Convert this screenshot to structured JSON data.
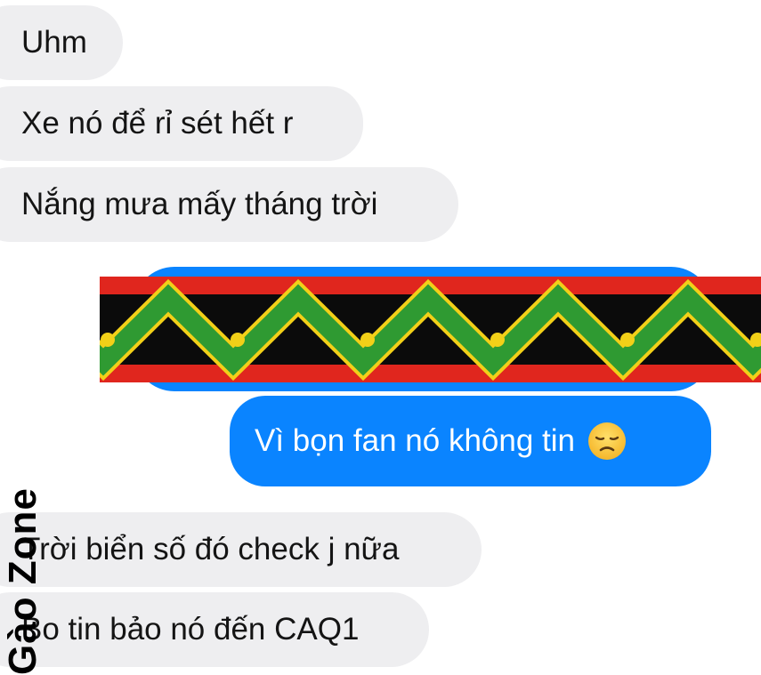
{
  "messages": [
    {
      "id": "m1",
      "direction": "incoming",
      "text": "Uhm"
    },
    {
      "id": "m2",
      "direction": "incoming",
      "text": "Xe nó để rỉ sét hết r"
    },
    {
      "id": "m3",
      "direction": "incoming",
      "text": "Nắng mưa mấy tháng trời"
    },
    {
      "id": "m4",
      "direction": "outgoing",
      "text": "Vì bọn fan nó không tin",
      "emoji": "disappointed-face"
    },
    {
      "id": "m5",
      "direction": "incoming",
      "text": "Trời biển số đó check j nữa"
    },
    {
      "id": "m6",
      "direction": "incoming",
      "text": "Bo tin bảo nó đến CAQ1"
    }
  ],
  "sticker": {
    "pattern": "zigzag-brocade",
    "colors": {
      "red": "#e0261e",
      "black": "#0b0b0b",
      "green": "#2f9a32",
      "yellow": "#f2d018"
    }
  },
  "watermark": {
    "text": "Gào Zone"
  },
  "colors": {
    "incoming_bubble": "#eeeef0",
    "outgoing_bubble": "#0a84ff"
  }
}
